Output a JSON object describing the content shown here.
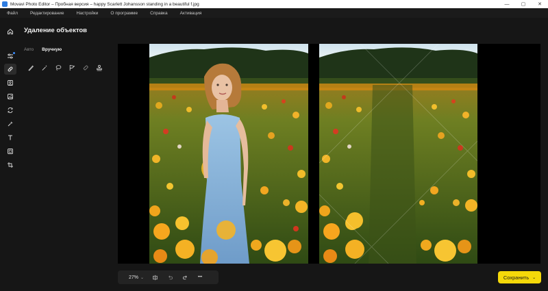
{
  "window": {
    "title": "Movavi Photo Editor – Пробная версия – happy Scarlett Johansson standing in a beautiful f.jpg",
    "controls": [
      "—",
      "▢",
      "✕"
    ]
  },
  "menu": [
    "Файл",
    "Редактирование",
    "Настройки",
    "О программе",
    "Справка",
    "Активация"
  ],
  "rail": {
    "items": [
      {
        "name": "home-icon"
      },
      {
        "name": "adjust-icon"
      },
      {
        "name": "object-removal-icon",
        "active": true
      },
      {
        "name": "portrait-icon"
      },
      {
        "name": "image-icon"
      },
      {
        "name": "replace-background-icon"
      },
      {
        "name": "effects-icon"
      },
      {
        "name": "text-icon"
      },
      {
        "name": "frames-icon"
      },
      {
        "name": "crop-icon"
      }
    ]
  },
  "panel": {
    "title": "Удаление объектов",
    "tabs": [
      "Авто",
      "Вручную"
    ],
    "active_tab": "Вручную",
    "tools": [
      "brush-icon",
      "magic-wand-icon",
      "lasso-icon",
      "flag-icon",
      "eraser-icon",
      "stamp-icon"
    ]
  },
  "canvas": {
    "background": "#000000"
  },
  "bottom_bar": {
    "zoom": "27%",
    "zoom_chevron": "⌄",
    "more": "•••"
  },
  "save": {
    "label": "Сохранить",
    "chevron": "⌄",
    "color": "#f5d90a"
  }
}
